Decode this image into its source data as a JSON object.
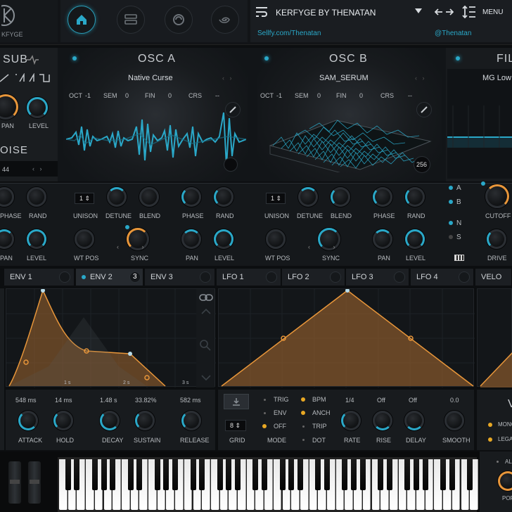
{
  "header": {
    "logo_text": "KFYGE",
    "preset_name": "KERFYGE BY THENATAN",
    "menu_label": "MENU",
    "link_left": "Sellfy.com/Thenatan",
    "link_right": "@Thenatan",
    "nav_icons": [
      "home-icon",
      "list-icon",
      "ring-icon",
      "spiral-icon"
    ]
  },
  "sub": {
    "title": "SUB",
    "pan": "PAN",
    "level": "LEVEL",
    "noise_title": "OISE",
    "noise_val": "44"
  },
  "osc_a": {
    "title": "OSC A",
    "wavetable": "Native Curse",
    "oct_l": "OCT",
    "oct": "-1",
    "sem_l": "SEM",
    "sem": "0",
    "fin_l": "FIN",
    "fin": "0",
    "crs_l": "CRS",
    "crs": "--",
    "unison": "1",
    "knobs": [
      "UNISON",
      "DETUNE",
      "BLEND",
      "PHASE",
      "RAND",
      "WT POS",
      "SYNC",
      "PAN",
      "LEVEL"
    ]
  },
  "osc_b": {
    "title": "OSC B",
    "wavetable": "SAM_SERUM",
    "oct_l": "OCT",
    "oct": "-1",
    "sem_l": "SEM",
    "sem": "0",
    "fin_l": "FIN",
    "fin": "0",
    "crs_l": "CRS",
    "crs": "--",
    "frames": "256",
    "unison": "1",
    "knobs": [
      "UNISON",
      "DETUNE",
      "BLEND",
      "PHASE",
      "RAND",
      "WT POS",
      "SYNC",
      "PAN",
      "LEVEL"
    ]
  },
  "left_col": {
    "phase": "PHASE",
    "rand": "RAND",
    "pan": "PAN",
    "level": "LEVEL"
  },
  "filter": {
    "title": "FIL",
    "type": "MG Low",
    "routes": [
      "A",
      "B",
      "N",
      "S"
    ],
    "cutoff": "CUTOFF",
    "drive": "DRIVE"
  },
  "mod_tabs": {
    "env1": "ENV 1",
    "env2": "ENV 2",
    "env2_count": "3",
    "env3": "ENV 3",
    "lfo1": "LFO 1",
    "lfo2": "LFO 2",
    "lfo3": "LFO 3",
    "lfo4": "LFO 4",
    "velo": "VELO"
  },
  "env": {
    "time_marks": [
      "1 s",
      "2 s",
      "3 s"
    ],
    "attack_val": "548 ms",
    "attack": "ATTACK",
    "hold_val": "14 ms",
    "hold": "HOLD",
    "decay_val": "1.48 s",
    "decay": "DECAY",
    "sustain_val": "33.82%",
    "sustain": "SUSTAIN",
    "release_val": "582 ms",
    "release": "RELEASE"
  },
  "lfo": {
    "grid_val": "8",
    "grid": "GRID",
    "trig": "TRIG",
    "env": "ENV",
    "off": "OFF",
    "mode": "MODE",
    "bpm": "BPM",
    "anch": "ANCH",
    "trip": "TRIP",
    "dot": "DOT",
    "rate_val": "1/4",
    "rate": "RATE",
    "rise_val": "Off",
    "rise": "RISE",
    "delay_val": "Off",
    "delay": "DELAY",
    "smooth_val": "0.0",
    "smooth": "SMOOTH"
  },
  "voicing": {
    "title": "V",
    "mono": "MONO",
    "legato": "LEGA",
    "always": "AL",
    "porta": "POR"
  },
  "colors": {
    "accent": "#2aa8c8",
    "orange": "#e8963a",
    "bg": "#0c0e10"
  }
}
